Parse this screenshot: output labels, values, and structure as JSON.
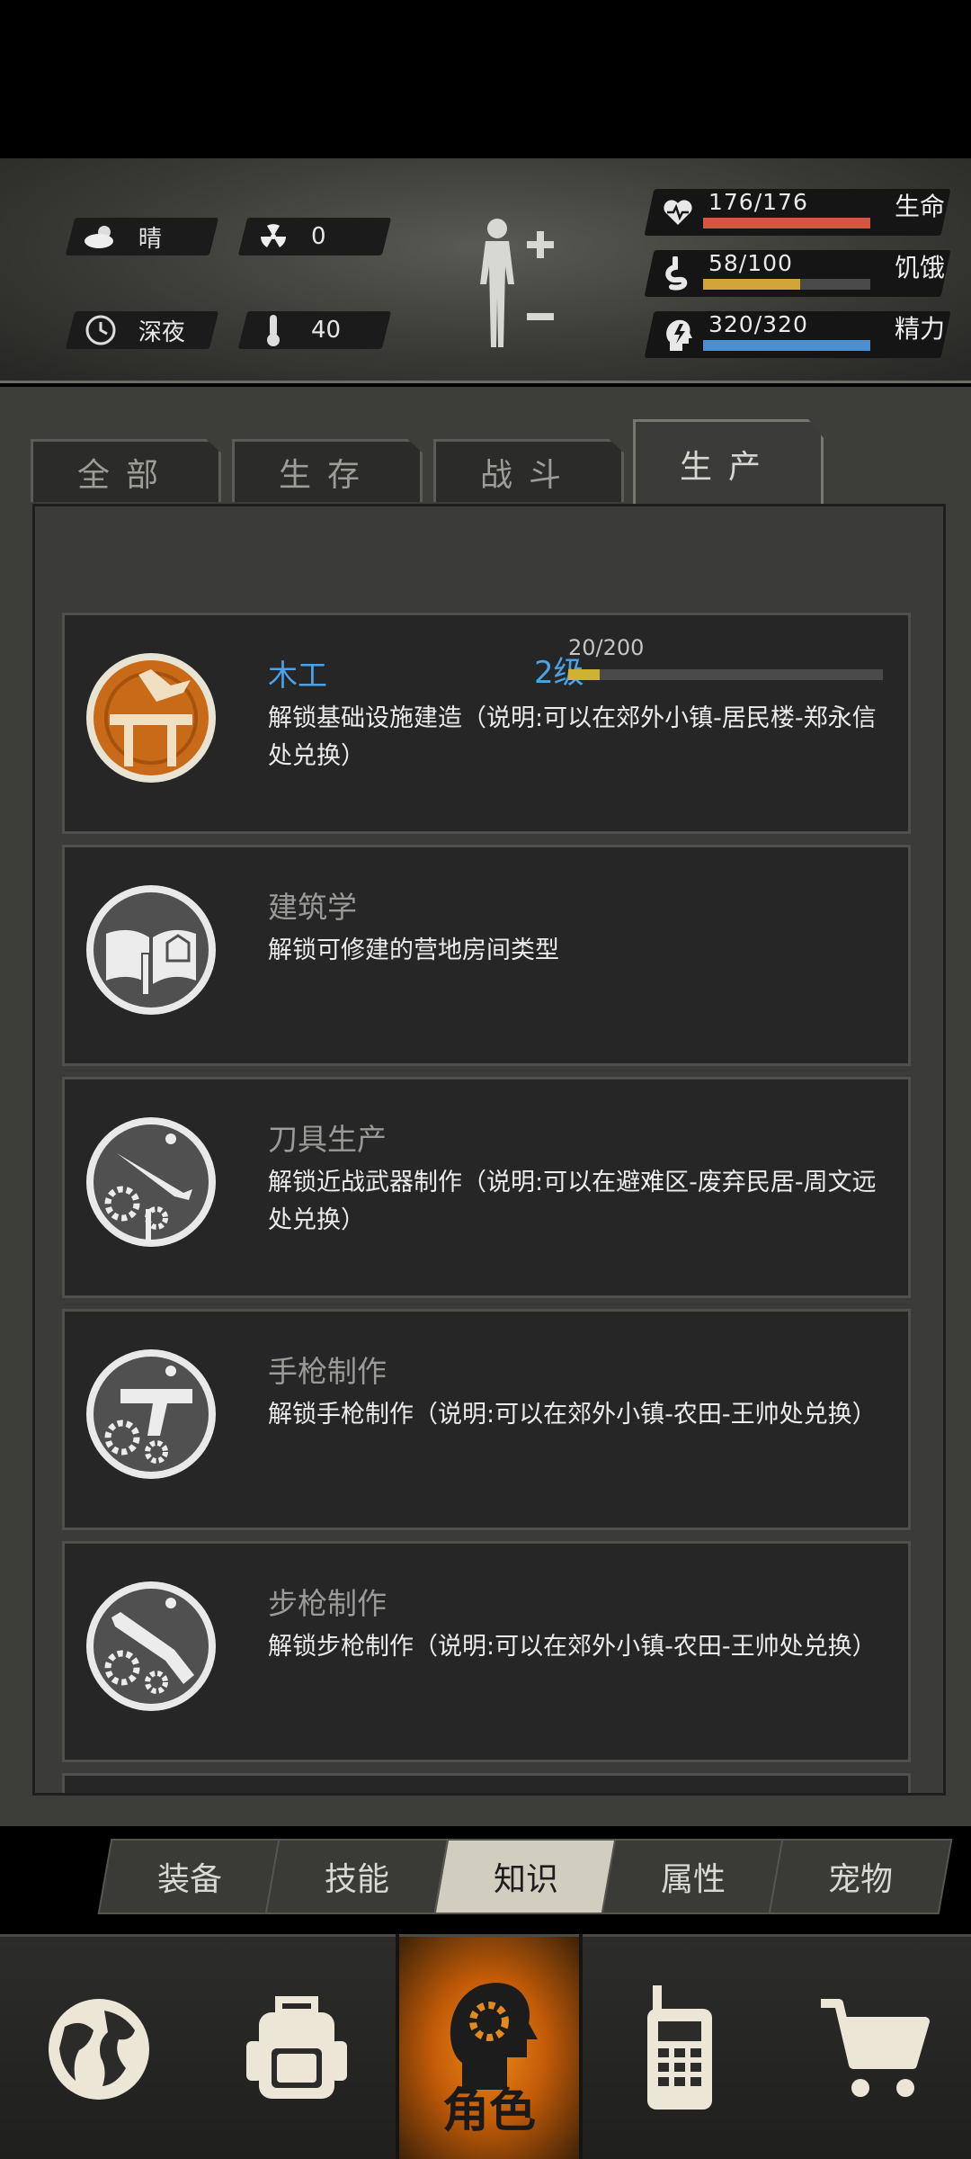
{
  "status": {
    "weather": "晴",
    "radiation": "0",
    "time_of_day": "深夜",
    "temperature": "40"
  },
  "vitals": [
    {
      "label": "生命",
      "value": "176/176",
      "fraction": 1.0,
      "color": "#d3543f",
      "icon": "heart-pulse-icon"
    },
    {
      "label": "饥饿",
      "value": "58/100",
      "fraction": 0.58,
      "color": "#d2a43a",
      "icon": "stomach-icon"
    },
    {
      "label": "精力",
      "value": "320/320",
      "fraction": 1.0,
      "color": "#4b8fcf",
      "icon": "head-energy-icon"
    }
  ],
  "tabs": [
    "全部",
    "生存",
    "战斗",
    "生产"
  ],
  "active_tab": "生产",
  "knowledge": [
    {
      "name": "木工",
      "level": "2级",
      "xp": "20/200",
      "xp_fraction": 0.1,
      "desc": "解锁基础设施建造（说明:可以在郊外小镇-居民楼-郑永信处兑换）",
      "icon": "carpentry-icon"
    },
    {
      "name": "建筑学",
      "desc": "解锁可修建的营地房间类型",
      "icon": "blueprint-book-icon"
    },
    {
      "name": "刀具生产",
      "desc": "解锁近战武器制作（说明:可以在避难区-废弃民居-周文远处兑换）",
      "icon": "knife-gear-icon"
    },
    {
      "name": "手枪制作",
      "desc": "解锁手枪制作（说明:可以在郊外小镇-农田-王帅处兑换）",
      "icon": "pistol-gear-icon"
    },
    {
      "name": "步枪制作",
      "desc": "解锁步枪制作（说明:可以在郊外小镇-农田-王帅处兑换）",
      "icon": "rifle-gear-icon"
    }
  ],
  "subtabs": [
    "装备",
    "技能",
    "知识",
    "属性",
    "宠物"
  ],
  "active_subtab": "知识",
  "bottom_nav": {
    "active_label": "角色"
  }
}
